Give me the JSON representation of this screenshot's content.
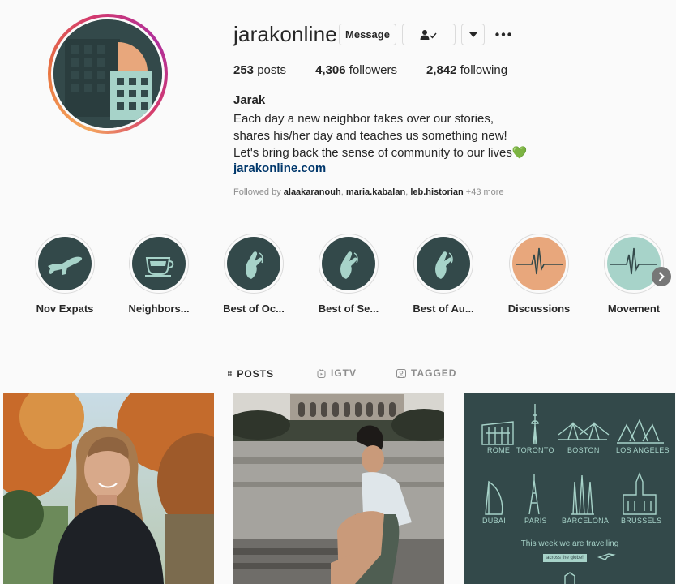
{
  "profile": {
    "username": "jarakonline",
    "message_label": "Message",
    "stats": {
      "posts_count": "253",
      "posts_label": "posts",
      "followers_count": "4,306",
      "followers_label": "followers",
      "following_count": "2,842",
      "following_label": "following"
    },
    "full_name": "Jarak",
    "bio_lines": [
      "Each day a new neighbor takes over our stories,",
      "shares his/her day and teaches us something new!",
      "Let's bring back the sense of community to our lives💚"
    ],
    "website": "jarakonline.com",
    "followed_by": {
      "prefix": "Followed by ",
      "users": [
        "alaakaranouh",
        "maria.kabalan",
        "leb.historian"
      ],
      "more": "+43 more"
    }
  },
  "highlights": [
    {
      "label": "Nov Expats",
      "icon": "airplane-icon"
    },
    {
      "label": "Neighbors...",
      "icon": "coffee-cup-icon"
    },
    {
      "label": "Best of Oc...",
      "icon": "hand-icon"
    },
    {
      "label": "Best of Se...",
      "icon": "hand-icon"
    },
    {
      "label": "Best of Au...",
      "icon": "hand-icon"
    },
    {
      "label": "Discussions",
      "icon": "heartbeat-icon"
    },
    {
      "label": "Movement",
      "icon": "heartbeat-icon"
    }
  ],
  "tabs": [
    {
      "label": "POSTS",
      "icon": "grid-icon",
      "active": true
    },
    {
      "label": "IGTV",
      "icon": "tv-icon",
      "active": false
    },
    {
      "label": "TAGGED",
      "icon": "tag-icon",
      "active": false
    }
  ],
  "posts": {
    "travel_post": {
      "cities": [
        "ROME",
        "TORONTO",
        "BOSTON",
        "LOS ANGELES",
        "DUBAI",
        "PARIS",
        "BARCELONA",
        "BRUSSELS"
      ],
      "caption": "This week we are travelling",
      "pill": "across the globe!"
    }
  },
  "colors": {
    "brand_dark": "#33494a",
    "brand_mint": "#a7d3c9",
    "brand_peach": "#e8a77c",
    "link": "#00376b"
  }
}
